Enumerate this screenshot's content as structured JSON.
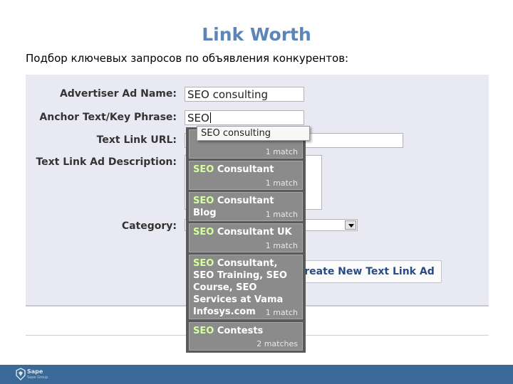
{
  "slide": {
    "title": "Link Worth",
    "subtitle": "Подбор ключевых запросов по объявления  конкурентов:"
  },
  "form": {
    "advertiser_label": "Advertiser Ad Name:",
    "advertiser_value": "SEO consulting",
    "anchor_label": "Anchor Text/Key Phrase:",
    "anchor_value": "SEO",
    "url_label": "Text Link URL:",
    "description_label": "Text Link Ad Description:",
    "category_label": "Category:",
    "create_button_label": "Create New Text Link Ad"
  },
  "tooltip": {
    "text": "SEO consulting"
  },
  "suggestions": [
    {
      "highlight": "",
      "rest": "",
      "count": "1 match"
    },
    {
      "highlight": "SEO",
      "rest": " Consultant",
      "count": "1 match"
    },
    {
      "highlight": "SEO",
      "rest": " Consultant Blog",
      "count": "1 match"
    },
    {
      "highlight": "SEO",
      "rest": " Consultant UK",
      "count": "1 match"
    },
    {
      "highlight": "SEO",
      "rest": " Consultant, SEO Training, SEO Course, SEO Services at Vama Infosys.com",
      "count": "1 match"
    },
    {
      "highlight": "SEO",
      "rest": " Contests",
      "count": "2 matches"
    }
  ],
  "footer": {
    "brand": "Sape",
    "tagline": "Sape Group",
    "color": "#3c6a98"
  }
}
